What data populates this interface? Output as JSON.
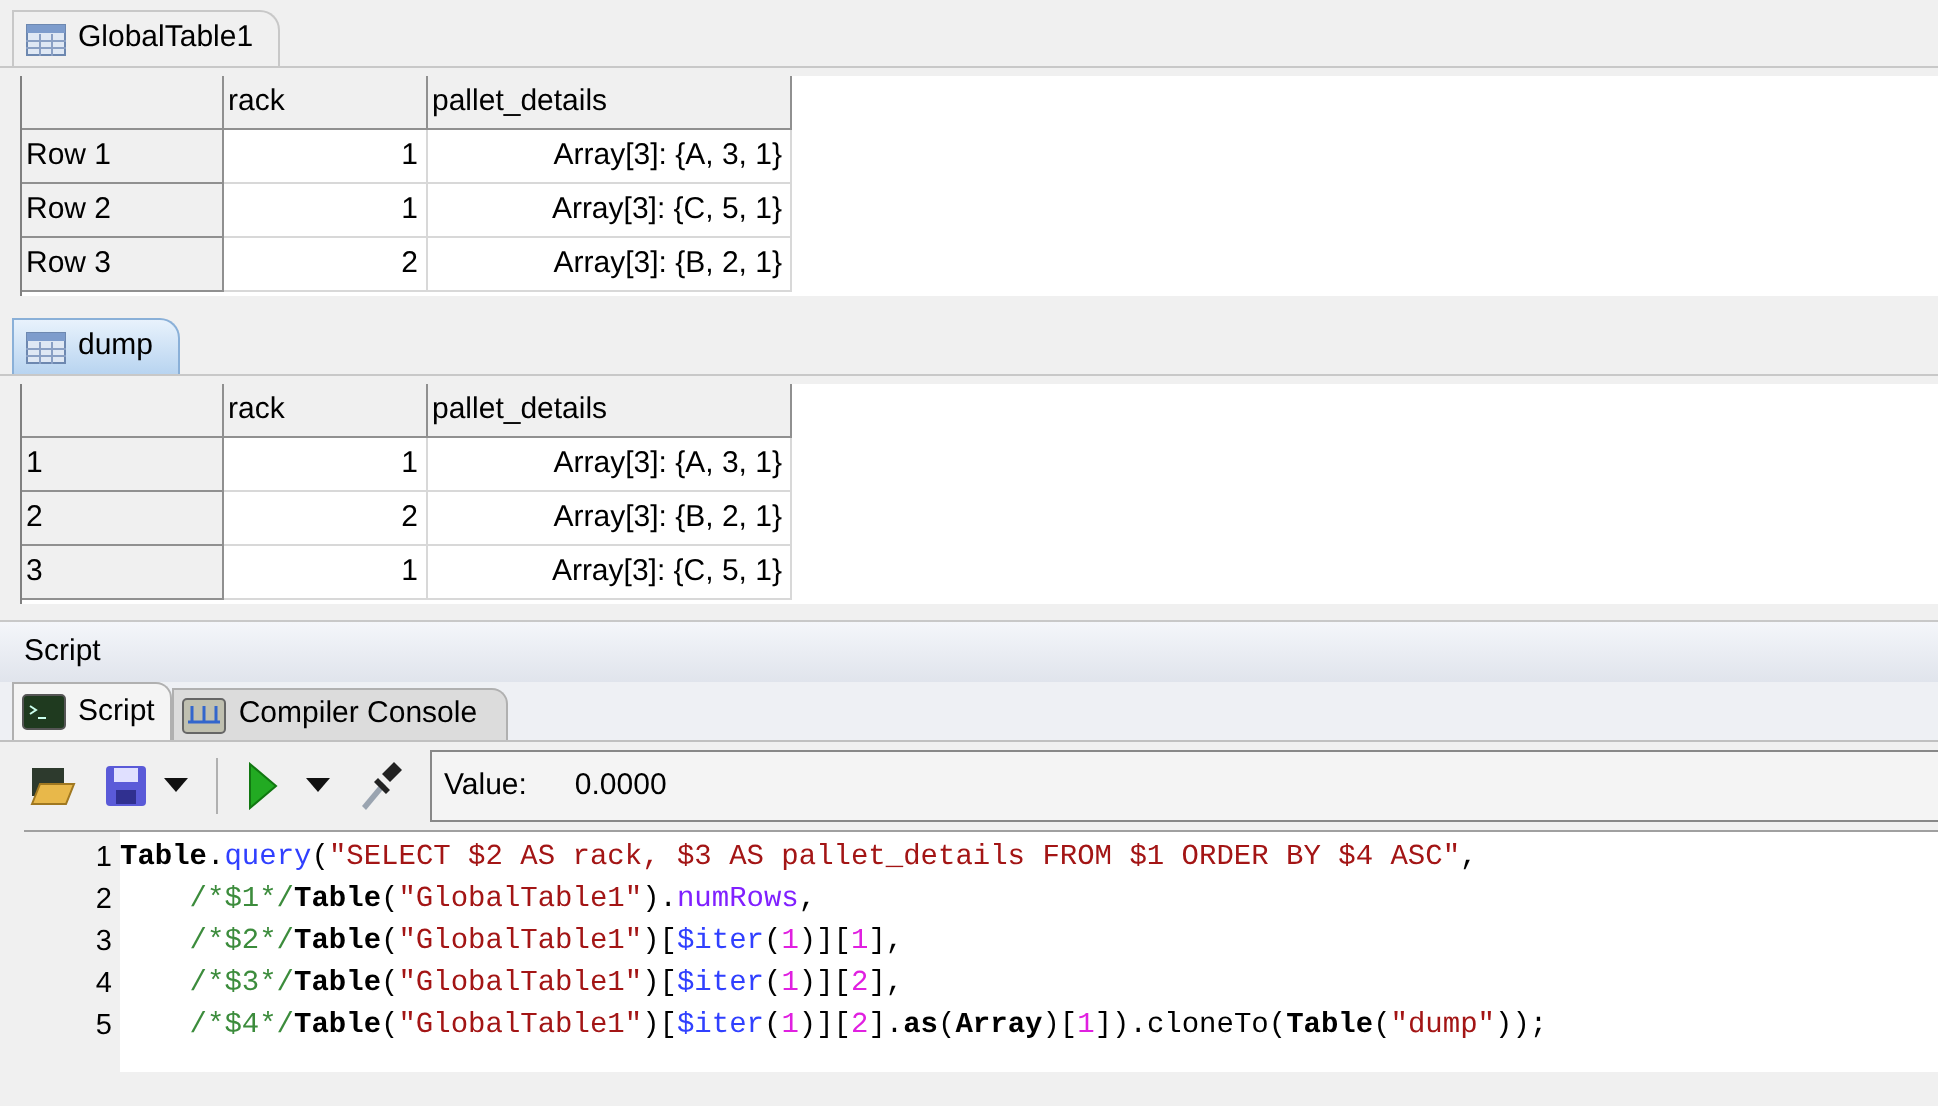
{
  "tables": [
    {
      "tab": {
        "label": "GlobalTable1",
        "selected": false
      },
      "columns": [
        "rack",
        "pallet_details"
      ],
      "rows": [
        {
          "header": "Row 1",
          "cells": [
            "1",
            "Array[3]: {A, 3, 1}"
          ]
        },
        {
          "header": "Row 2",
          "cells": [
            "1",
            "Array[3]: {C, 5, 1}"
          ]
        },
        {
          "header": "Row 3",
          "cells": [
            "2",
            "Array[3]: {B, 2, 1}"
          ]
        }
      ]
    },
    {
      "tab": {
        "label": "dump",
        "selected": true
      },
      "columns": [
        "rack",
        "pallet_details"
      ],
      "rows": [
        {
          "header": "1",
          "cells": [
            "1",
            "Array[3]: {A, 3, 1}"
          ]
        },
        {
          "header": "2",
          "cells": [
            "2",
            "Array[3]: {B, 2, 1}"
          ]
        },
        {
          "header": "3",
          "cells": [
            "1",
            "Array[3]: {C, 5, 1}"
          ]
        }
      ]
    }
  ],
  "script_panel": {
    "title": "Script",
    "tabs": [
      {
        "label": "Script",
        "selected": true,
        "kind": "terminal"
      },
      {
        "label": "Compiler Console",
        "selected": false,
        "kind": "console"
      }
    ],
    "value_label": "Value:",
    "value": "0.0000",
    "code": [
      {
        "number": "1",
        "indented": false,
        "tokens": [
          {
            "kind": "kw",
            "text": "Table"
          },
          {
            "kind": "plain",
            "text": "."
          },
          {
            "kind": "method",
            "text": "query"
          },
          {
            "kind": "plain",
            "text": "("
          },
          {
            "kind": "str",
            "text": "\"SELECT $2 AS rack, $3 AS pallet_details FROM $1 ORDER BY $4 ASC\""
          },
          {
            "kind": "plain",
            "text": ","
          }
        ]
      },
      {
        "number": "2",
        "indented": true,
        "tokens": [
          {
            "kind": "comment",
            "text": "/*$1*/"
          },
          {
            "kind": "kw",
            "text": "Table"
          },
          {
            "kind": "plain",
            "text": "("
          },
          {
            "kind": "str",
            "text": "\"GlobalTable1\""
          },
          {
            "kind": "plain",
            "text": ")."
          },
          {
            "kind": "prop",
            "text": "numRows"
          },
          {
            "kind": "plain",
            "text": ","
          }
        ]
      },
      {
        "number": "3",
        "indented": true,
        "tokens": [
          {
            "kind": "comment",
            "text": "/*$2*/"
          },
          {
            "kind": "kw",
            "text": "Table"
          },
          {
            "kind": "plain",
            "text": "("
          },
          {
            "kind": "str",
            "text": "\"GlobalTable1\""
          },
          {
            "kind": "plain",
            "text": ")["
          },
          {
            "kind": "method",
            "text": "$iter"
          },
          {
            "kind": "plain",
            "text": "("
          },
          {
            "kind": "num",
            "text": "1"
          },
          {
            "kind": "plain",
            "text": ")]["
          },
          {
            "kind": "num",
            "text": "1"
          },
          {
            "kind": "plain",
            "text": "],"
          }
        ]
      },
      {
        "number": "4",
        "indented": true,
        "tokens": [
          {
            "kind": "comment",
            "text": "/*$3*/"
          },
          {
            "kind": "kw",
            "text": "Table"
          },
          {
            "kind": "plain",
            "text": "("
          },
          {
            "kind": "str",
            "text": "\"GlobalTable1\""
          },
          {
            "kind": "plain",
            "text": ")["
          },
          {
            "kind": "method",
            "text": "$iter"
          },
          {
            "kind": "plain",
            "text": "("
          },
          {
            "kind": "num",
            "text": "1"
          },
          {
            "kind": "plain",
            "text": ")]["
          },
          {
            "kind": "num",
            "text": "2"
          },
          {
            "kind": "plain",
            "text": "],"
          }
        ]
      },
      {
        "number": "5",
        "indented": true,
        "tokens": [
          {
            "kind": "comment",
            "text": "/*$4*/"
          },
          {
            "kind": "kw",
            "text": "Table"
          },
          {
            "kind": "plain",
            "text": "("
          },
          {
            "kind": "str",
            "text": "\"GlobalTable1\""
          },
          {
            "kind": "plain",
            "text": ")["
          },
          {
            "kind": "method",
            "text": "$iter"
          },
          {
            "kind": "plain",
            "text": "("
          },
          {
            "kind": "num",
            "text": "1"
          },
          {
            "kind": "plain",
            "text": ")]["
          },
          {
            "kind": "num",
            "text": "2"
          },
          {
            "kind": "plain",
            "text": "]."
          },
          {
            "kind": "kw",
            "text": "as"
          },
          {
            "kind": "plain",
            "text": "("
          },
          {
            "kind": "kw",
            "text": "Array"
          },
          {
            "kind": "plain",
            "text": ")["
          },
          {
            "kind": "num",
            "text": "1"
          },
          {
            "kind": "plain",
            "text": "]).cloneTo("
          },
          {
            "kind": "kw",
            "text": "Table"
          },
          {
            "kind": "plain",
            "text": "("
          },
          {
            "kind": "str",
            "text": "\"dump\""
          },
          {
            "kind": "plain",
            "text": "));"
          }
        ]
      }
    ]
  }
}
